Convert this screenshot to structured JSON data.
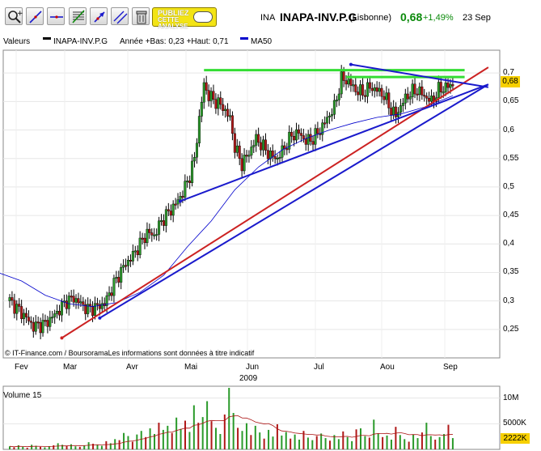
{
  "header": {
    "market": "INA",
    "name": "INAPA-INV.P.G",
    "exchange": "(Lisbonne)",
    "price": "0,68",
    "change": "+1,49%",
    "date": "23 Sep"
  },
  "toolbar": {
    "tools": [
      "zoom-icon",
      "line-icon",
      "horizontal-line-icon",
      "trend-channel-icon",
      "arrow-icon",
      "parallel-lines-icon",
      "trash-icon"
    ],
    "publish_line1": "PUBLIEZ",
    "publish_line2": "CETTE ANALYSE"
  },
  "legend": {
    "label": "Valeurs",
    "series1": "INAPA-INV.P.G",
    "stats": "Année +Bas: 0,23 +Haut: 0,71",
    "series2": "MA50",
    "series1_color": "#000000",
    "series2_color": "#0000cc"
  },
  "credit": "© IT-Finance.com / BoursoramaLes informations sont données à titre indicatif",
  "chart_data": {
    "type": "candlestick",
    "year_label": "2009",
    "months": [
      "Fev",
      "Mar",
      "Avr",
      "Mai",
      "Jun",
      "Jul",
      "Aou",
      "Sep"
    ],
    "y_ticks": [
      "0,7",
      "0,65",
      "0,6",
      "0,55",
      "0,5",
      "0,45",
      "0,4",
      "0,35",
      "0,3",
      "0,25"
    ],
    "ylim": [
      0.2,
      0.74
    ],
    "last_price": "0,68",
    "price_path": [
      [
        0,
        0.3
      ],
      [
        6,
        0.275
      ],
      [
        10,
        0.255
      ],
      [
        15,
        0.26
      ],
      [
        20,
        0.28
      ],
      [
        24,
        0.3
      ],
      [
        27,
        0.305
      ],
      [
        30,
        0.295
      ],
      [
        33,
        0.285
      ],
      [
        37,
        0.29
      ],
      [
        40,
        0.295
      ],
      [
        44,
        0.33
      ],
      [
        48,
        0.36
      ],
      [
        52,
        0.38
      ],
      [
        55,
        0.4
      ],
      [
        58,
        0.42
      ],
      [
        61,
        0.415
      ],
      [
        64,
        0.44
      ],
      [
        67,
        0.455
      ],
      [
        70,
        0.47
      ],
      [
        73,
        0.49
      ],
      [
        76,
        0.52
      ],
      [
        78,
        0.55
      ],
      [
        80,
        0.62
      ],
      [
        82,
        0.68
      ],
      [
        84,
        0.66
      ],
      [
        87,
        0.65
      ],
      [
        90,
        0.64
      ],
      [
        93,
        0.62
      ],
      [
        95,
        0.57
      ],
      [
        98,
        0.54
      ],
      [
        101,
        0.56
      ],
      [
        104,
        0.585
      ],
      [
        107,
        0.57
      ],
      [
        110,
        0.555
      ],
      [
        113,
        0.55
      ],
      [
        116,
        0.57
      ],
      [
        119,
        0.59
      ],
      [
        122,
        0.595
      ],
      [
        125,
        0.58
      ],
      [
        128,
        0.585
      ],
      [
        131,
        0.6
      ],
      [
        134,
        0.62
      ],
      [
        137,
        0.64
      ],
      [
        140,
        0.69
      ],
      [
        143,
        0.685
      ],
      [
        146,
        0.67
      ],
      [
        149,
        0.665
      ],
      [
        152,
        0.675
      ],
      [
        155,
        0.67
      ],
      [
        158,
        0.66
      ],
      [
        161,
        0.635
      ],
      [
        163,
        0.625
      ],
      [
        166,
        0.65
      ],
      [
        169,
        0.665
      ],
      [
        172,
        0.67
      ],
      [
        175,
        0.66
      ],
      [
        178,
        0.65
      ],
      [
        181,
        0.67
      ],
      [
        184,
        0.675
      ],
      [
        187,
        0.68
      ]
    ],
    "ma50": [
      [
        -5,
        0.35
      ],
      [
        5,
        0.335
      ],
      [
        15,
        0.31
      ],
      [
        25,
        0.295
      ],
      [
        35,
        0.29
      ],
      [
        45,
        0.297
      ],
      [
        55,
        0.315
      ],
      [
        65,
        0.345
      ],
      [
        75,
        0.395
      ],
      [
        85,
        0.44
      ],
      [
        95,
        0.495
      ],
      [
        105,
        0.535
      ],
      [
        115,
        0.565
      ],
      [
        125,
        0.585
      ],
      [
        135,
        0.6
      ],
      [
        145,
        0.612
      ],
      [
        155,
        0.622
      ],
      [
        165,
        0.628
      ],
      [
        175,
        0.64
      ],
      [
        187,
        0.66
      ]
    ],
    "annotations": [
      {
        "type": "resistance",
        "color": "#33dd33",
        "points": [
          [
            82,
            0.705
          ],
          [
            192,
            0.705
          ]
        ]
      },
      {
        "type": "resistance",
        "color": "#33dd33",
        "points": [
          [
            142,
            0.693
          ],
          [
            192,
            0.693
          ]
        ]
      },
      {
        "type": "trend-red",
        "color": "#cc2222",
        "points": [
          [
            22,
            0.235
          ],
          [
            202,
            0.71
          ]
        ]
      },
      {
        "type": "trend-blue",
        "color": "#1a1acc",
        "points": [
          [
            38,
            0.27
          ],
          [
            202,
            0.68
          ]
        ]
      },
      {
        "type": "trend-blue",
        "color": "#1a1acc",
        "points": [
          [
            72,
            0.475
          ],
          [
            202,
            0.68
          ]
        ]
      },
      {
        "type": "trend-blue",
        "color": "#1a1acc",
        "points": [
          [
            144,
            0.715
          ],
          [
            202,
            0.675
          ]
        ]
      }
    ],
    "volume": {
      "label": "Volume 15",
      "y_ticks": [
        "10M",
        "5000K"
      ],
      "last": "2222K",
      "ylim": [
        0,
        12
      ],
      "values_m": [
        0.6,
        0.4,
        0.8,
        0.5,
        0.3,
        0.9,
        0.7,
        0.5,
        0.4,
        0.6,
        0.8,
        1.2,
        0.9,
        0.7,
        1.0,
        0.6,
        0.5,
        0.8,
        1.4,
        1.1,
        0.9,
        0.7,
        1.6,
        1.2,
        2.0,
        1.8,
        3.2,
        2.6,
        1.5,
        2.9,
        3.6,
        2.4,
        4.1,
        3.0,
        5.2,
        3.8,
        4.6,
        3.2,
        6.2,
        4.0,
        5.6,
        3.4,
        8.6,
        5.2,
        6.3,
        9.4,
        5.5,
        4.2,
        3.0,
        6.8,
        12.0,
        7.1,
        4.2,
        3.6,
        5.1,
        2.8,
        4.6,
        3.3,
        2.1,
        3.8,
        2.5,
        4.9,
        2.7,
        3.4,
        2.1,
        2.9,
        1.9,
        3.6,
        2.3,
        1.8,
        2.6,
        3.1,
        2.2,
        1.7,
        2.8,
        2.0,
        3.5,
        2.4,
        1.6,
        3.9,
        4.1,
        2.6,
        2.3,
        5.8,
        3.1,
        2.4,
        2.7,
        1.9,
        4.4,
        2.8,
        2.0,
        1.5,
        2.9,
        2.2,
        3.3,
        5.2,
        2.6,
        1.9,
        2.4,
        3.0,
        4.8,
        2.2
      ]
    }
  }
}
